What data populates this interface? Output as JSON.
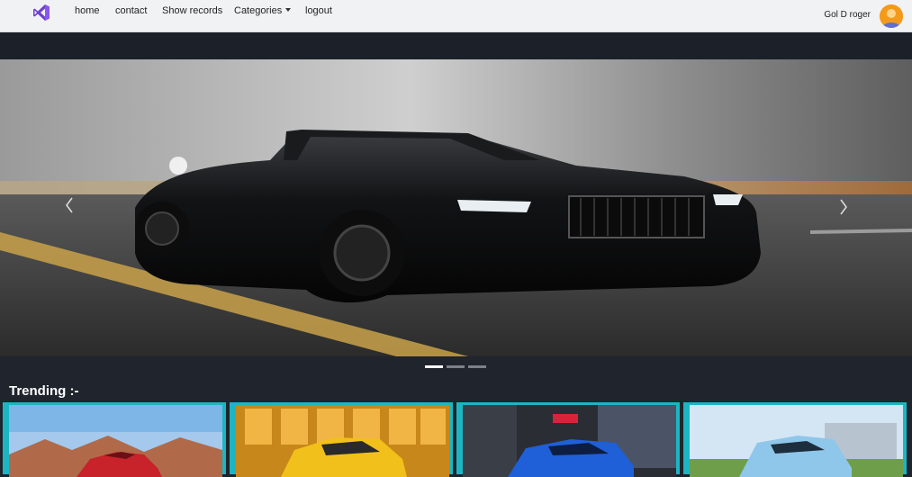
{
  "navbar": {
    "brand_icon": "visual-studio-logo-icon",
    "links": [
      {
        "label": "home"
      },
      {
        "label": "contact"
      },
      {
        "label": "Show records"
      },
      {
        "label": "Categories"
      },
      {
        "label": "logout"
      }
    ],
    "user_name": "Gol D roger",
    "avatar_icon": "user-avatar-icon"
  },
  "carousel": {
    "slide_image": "black-convertible-car-photo",
    "prev_icon": "chevron-left-icon",
    "next_icon": "chevron-right-icon",
    "active_slide": 1,
    "slide_count": 3
  },
  "trending": {
    "title": "Trending :-",
    "cards": [
      {
        "image": "red-hatchback-car-photo"
      },
      {
        "image": "yellow-suv-car-photo"
      },
      {
        "image": "blue-sedan-car-photo"
      },
      {
        "image": "light-blue-hatchback-car-photo"
      }
    ]
  },
  "colors": {
    "navbar_bg": "#f1f2f4",
    "page_bg": "#1f242d",
    "card_border": "#1db5c2",
    "brand_purple": "#7b3fe4"
  }
}
